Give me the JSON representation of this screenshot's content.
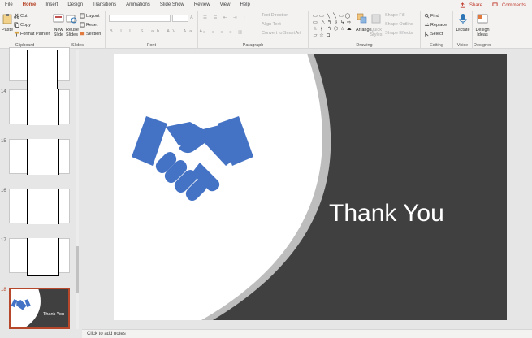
{
  "tabs": [
    "File",
    "Home",
    "Insert",
    "Design",
    "Transitions",
    "Animations",
    "Slide Show",
    "Review",
    "View",
    "Help"
  ],
  "tab_right": {
    "share": "Share",
    "comments": "Comments"
  },
  "ribbon": {
    "clipboard": {
      "paste": "Paste",
      "cut": "Cut",
      "copy": "Copy",
      "format_painter": "Format Painter",
      "label": "Clipboard"
    },
    "slides": {
      "new_slide": "New Slide",
      "reuse_slides": "Reuse Slides",
      "layout": "Layout",
      "reset": "Reset",
      "section": "Section",
      "label": "Slides"
    },
    "font": {
      "label": "Font"
    },
    "paragraph": {
      "text_direction": "Text Direction",
      "align_text": "Align Text",
      "convert_smartart": "Convert to SmartArt",
      "label": "Paragraph"
    },
    "drawing": {
      "arrange": "Arrange",
      "quick_styles": "Quick Styles",
      "shape_fill": "Shape Fill",
      "shape_outline": "Shape Outline",
      "shape_effects": "Shape Effects",
      "label": "Drawing"
    },
    "editing": {
      "find": "Find",
      "replace": "Replace",
      "select": "Select",
      "label": "Editing"
    },
    "voice": {
      "dictate": "Dictate",
      "label": "Voice"
    },
    "designer": {
      "design_ideas": "Design Ideas",
      "label": "Designer"
    }
  },
  "thumbnails": [
    {
      "num": "14"
    },
    {
      "num": "15"
    },
    {
      "num": "16"
    },
    {
      "num": "17"
    },
    {
      "num": "18",
      "text": "Thank You"
    }
  ],
  "slide": {
    "title": "Thank You"
  },
  "notes_placeholder": "Click to add notes",
  "colors": {
    "accent": "#b7472a",
    "dark_panel": "#404040",
    "icon_blue": "#4472c4"
  }
}
